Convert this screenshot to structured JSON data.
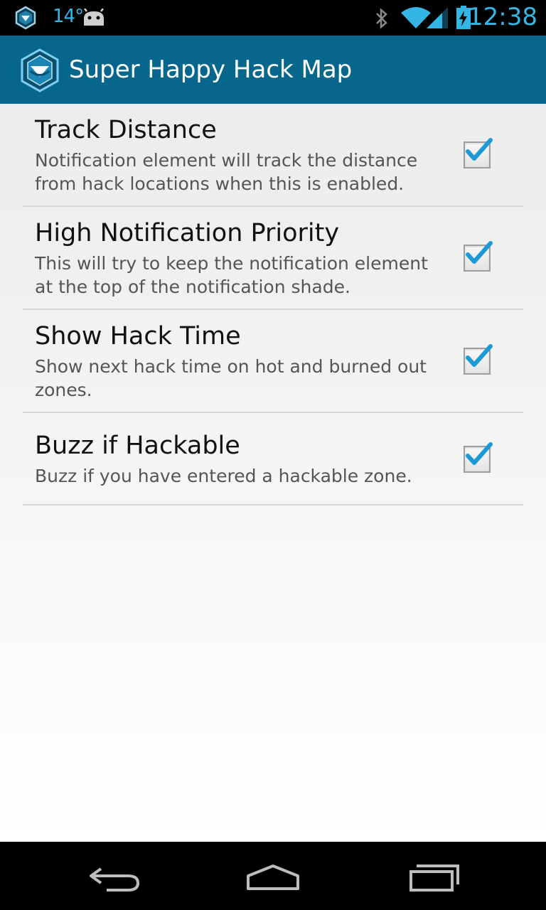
{
  "status_bar": {
    "left_icons": [
      "ingress-notification-icon",
      "android-icon"
    ],
    "temperature": "14°",
    "right_icons": [
      "bluetooth-icon",
      "wifi-icon",
      "signal-icon",
      "battery-charging-icon"
    ],
    "time": "12:38",
    "accent_color": "#33b5e5"
  },
  "action_bar": {
    "title": "Super Happy Hack Map",
    "background_color": "#06668b",
    "icon": "app-hexagon-icon"
  },
  "preferences": [
    {
      "title": "Track Distance",
      "summary": "Notification element will track the distance from hack locations when this is enabled.",
      "checked": true
    },
    {
      "title": "High Notification Priority",
      "summary": "This will try to keep the notification element at the top of the notification shade.",
      "checked": true
    },
    {
      "title": "Show Hack Time",
      "summary": "Show next hack time on hot and burned out zones.",
      "checked": true
    },
    {
      "title": "Buzz if Hackable",
      "summary": "Buzz if you have entered a hackable zone.",
      "checked": true
    }
  ],
  "nav_bar": {
    "buttons": [
      "back-icon",
      "home-icon",
      "recent-apps-icon"
    ]
  }
}
